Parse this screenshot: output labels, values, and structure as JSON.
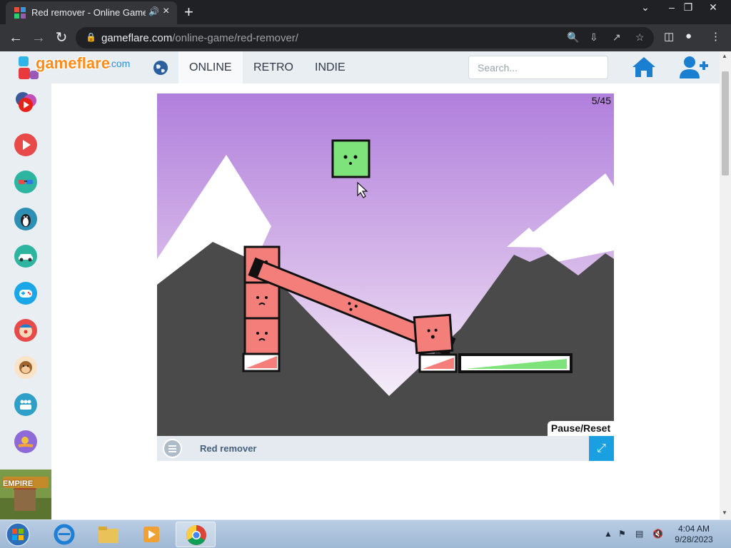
{
  "browser": {
    "tab_title": "Red remover - Online Game",
    "new_tab": "+",
    "url_host": "gameflare.com",
    "url_path": "/online-game/red-remover/"
  },
  "site": {
    "logo_text": "gameflare",
    "logo_domain": ".com",
    "nav": [
      "ONLINE",
      "RETRO",
      "INDIE"
    ],
    "search_placeholder": "Search..."
  },
  "game": {
    "level_counter": "5/45",
    "pause_reset_label": "Pause/Reset",
    "name": "Red remover"
  },
  "promo": {
    "label": "EMPIRE"
  },
  "taskbar": {
    "time": "4:04 AM",
    "date": "9/28/2023"
  },
  "colors": {
    "sky_top": "#b07fdc",
    "red_block": "#f47f7a",
    "green_block": "#7ee37a",
    "mountain": "#4a4a4a",
    "accent": "#1a9fe0"
  }
}
